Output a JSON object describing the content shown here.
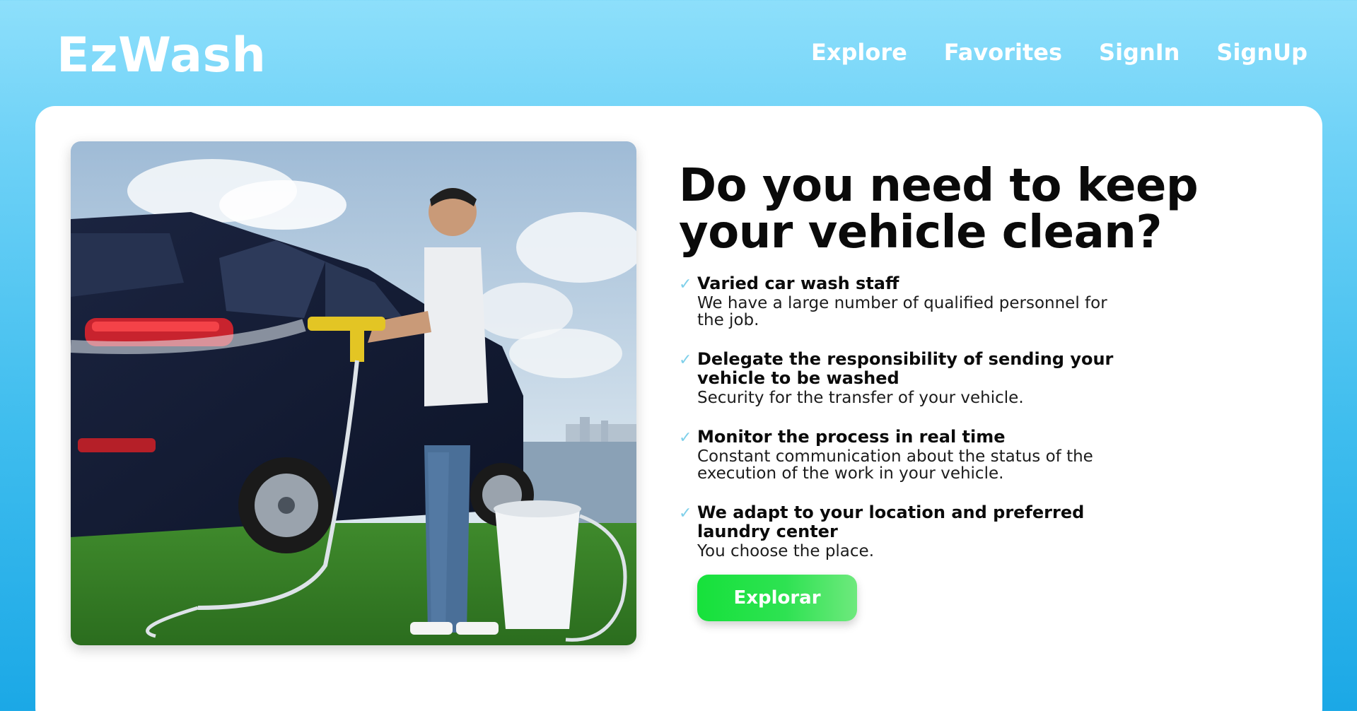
{
  "header": {
    "logo": "EzWash",
    "nav": [
      "Explore",
      "Favorites",
      "SignIn",
      "SignUp"
    ]
  },
  "hero": {
    "headline": "Do you need to keep your vehicle clean?",
    "features": [
      {
        "title": "Varied car wash staff",
        "desc": "We have a large number of qualified personnel for the job."
      },
      {
        "title": "Delegate the responsibility of sending your vehicle to be washed",
        "desc": "Security for the transfer of your vehicle."
      },
      {
        "title": "Monitor the process in real time",
        "desc": "Constant communication about the status of the execution of the work in your vehicle."
      },
      {
        "title": "We adapt to your location and preferred laundry center",
        "desc": "You choose the place."
      }
    ],
    "cta_label": "Explorar",
    "check_icon": "check-icon"
  },
  "colors": {
    "bg_top": "#8ddffb",
    "bg_bottom": "#1ba8e6",
    "cta_start": "#16e13b",
    "cta_end": "#6ee97d",
    "check": "#7fd0ea"
  }
}
